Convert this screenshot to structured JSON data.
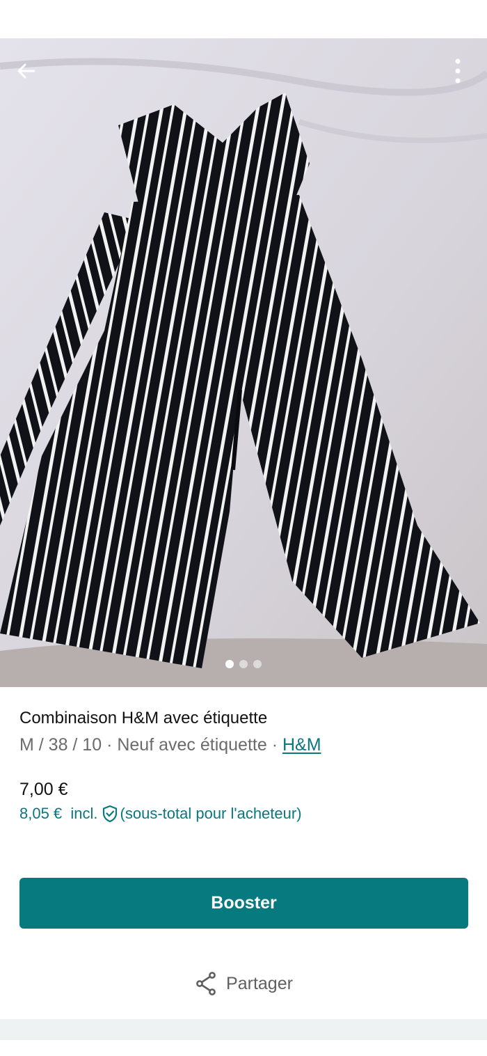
{
  "header": {
    "back_icon": "arrow-left-icon",
    "menu_icon": "more-vertical-icon"
  },
  "gallery": {
    "description_icon": "product-photo",
    "photo_count": 3,
    "active_index": 0
  },
  "item": {
    "title": "Combinaison H&M avec étiquette",
    "size": "M / 38 / 10",
    "separator": " · ",
    "condition": "Neuf avec étiquette",
    "brand": "H&M",
    "price": "7,00 €",
    "buyer_price": "8,05 €",
    "buyer_incl": "incl.",
    "buyer_note": "(sous-total pour l'acheteur)",
    "buyer_icon": "shield-check-icon"
  },
  "actions": {
    "booster_label": "Booster",
    "share_label": "Partager",
    "share_icon": "share-icon"
  },
  "colors": {
    "accent": "#077a80",
    "link": "#09787e",
    "muted": "#6b6b6b"
  }
}
